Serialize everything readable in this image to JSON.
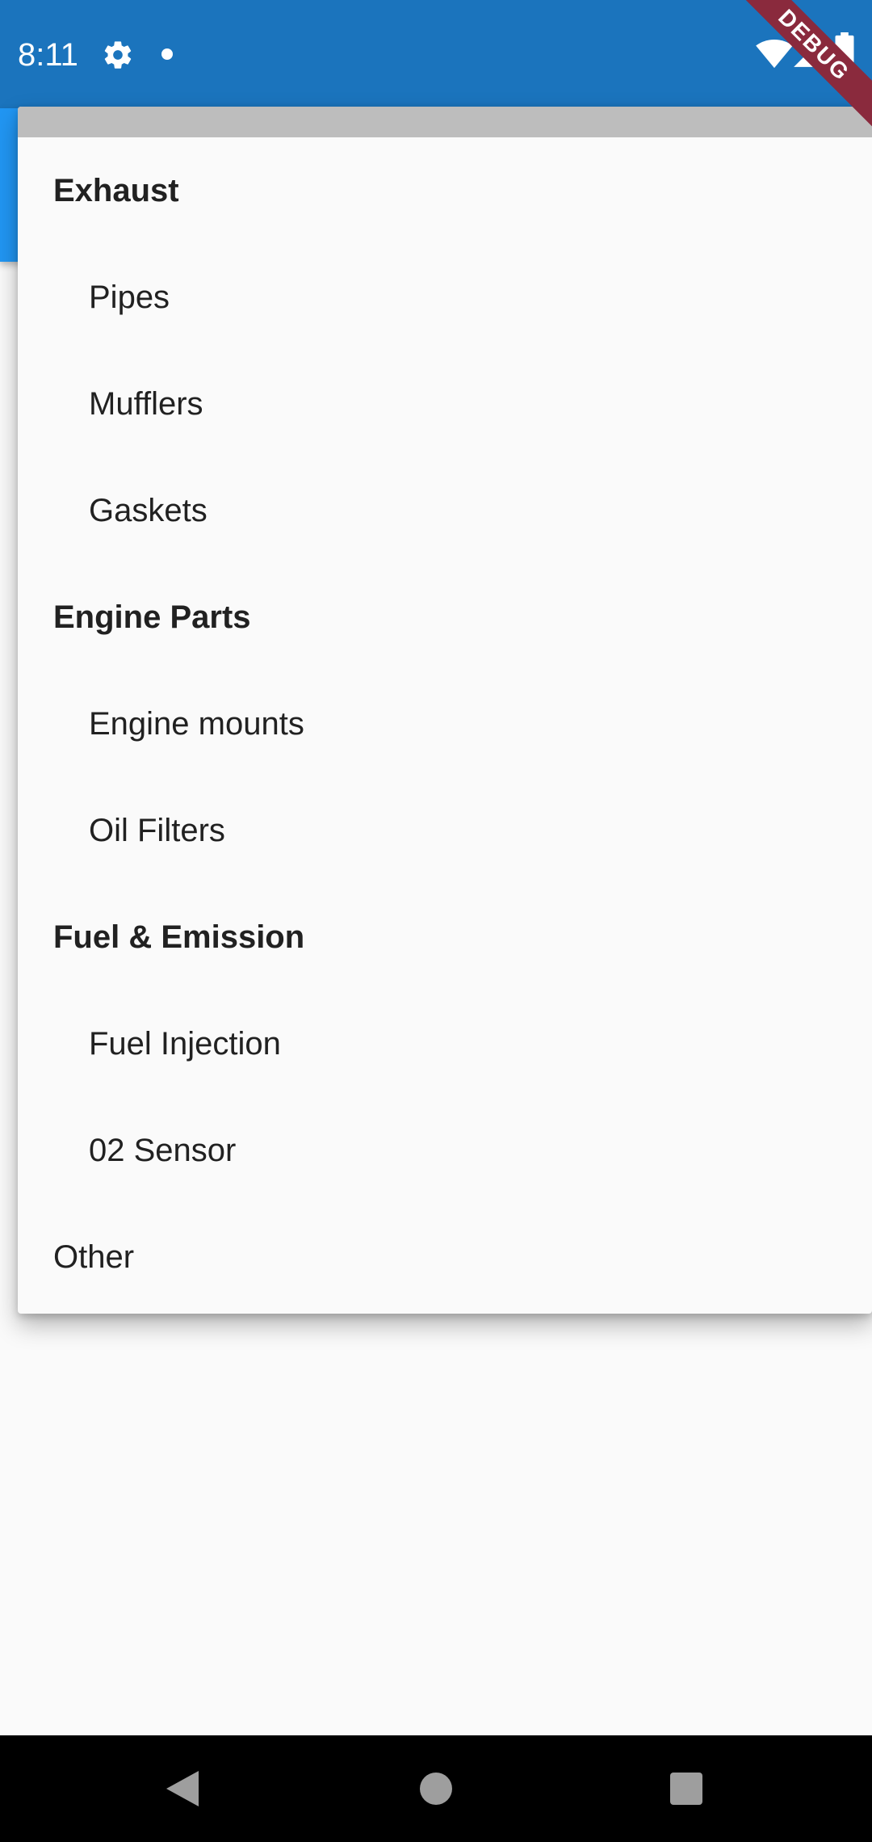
{
  "status_bar": {
    "time": "8:11",
    "icons": [
      "gear-icon",
      "notification-dot-icon",
      "wifi-icon",
      "signal-icon",
      "battery-icon"
    ],
    "background": "#1b74bd"
  },
  "app_bar": {
    "background": "#2196f3"
  },
  "debug_banner": {
    "label": "DEBUG",
    "color": "#8a2a3d"
  },
  "popup_menu": {
    "items": [
      {
        "label": "Exhaust",
        "kind": "header"
      },
      {
        "label": "Pipes",
        "kind": "sub"
      },
      {
        "label": "Mufflers",
        "kind": "sub"
      },
      {
        "label": "Gaskets",
        "kind": "sub"
      },
      {
        "label": "Engine Parts",
        "kind": "header"
      },
      {
        "label": "Engine mounts",
        "kind": "sub"
      },
      {
        "label": "Oil Filters",
        "kind": "sub"
      },
      {
        "label": "Fuel & Emission",
        "kind": "header"
      },
      {
        "label": "Fuel Injection",
        "kind": "sub"
      },
      {
        "label": "02 Sensor",
        "kind": "sub"
      },
      {
        "label": "Other",
        "kind": "plain"
      }
    ]
  },
  "nav_bar": {
    "icons": [
      "back-icon",
      "home-icon",
      "recents-icon"
    ]
  }
}
